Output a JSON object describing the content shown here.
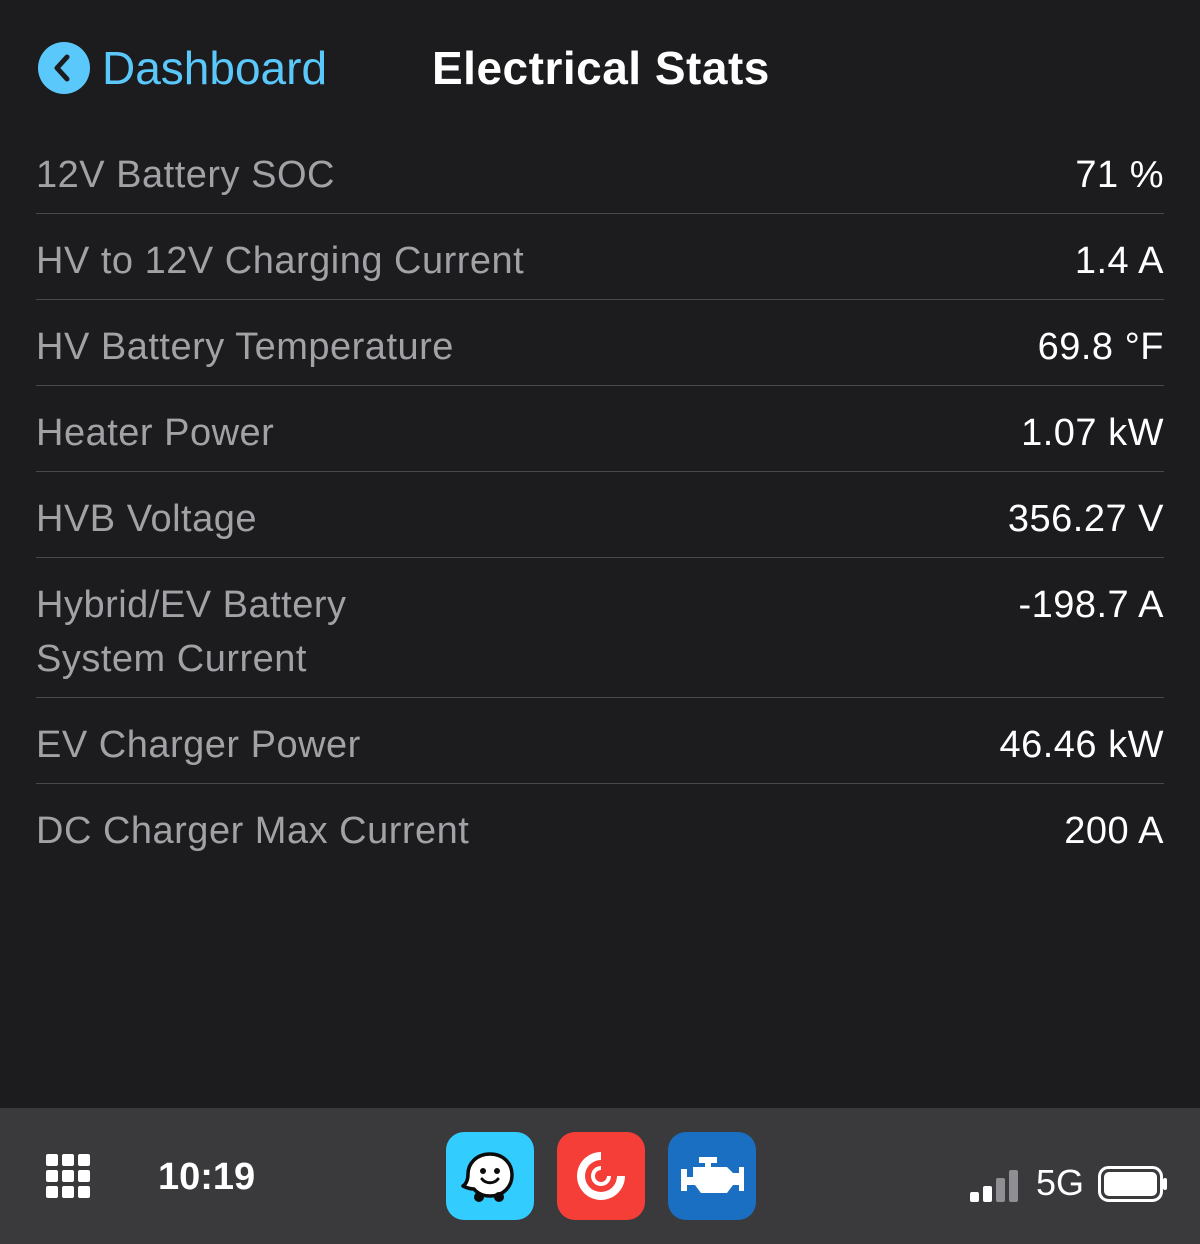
{
  "nav": {
    "back_label": "Dashboard",
    "title": "Electrical Stats"
  },
  "stats": [
    {
      "label": "12V Battery SOC",
      "value": "71 %"
    },
    {
      "label": "HV to 12V Charging Current",
      "value": "1.4 A"
    },
    {
      "label": "HV Battery Temperature",
      "value": "69.8 °F"
    },
    {
      "label": "Heater Power",
      "value": "1.07 kW"
    },
    {
      "label": "HVB Voltage",
      "value": "356.27 V"
    },
    {
      "label": "Hybrid/EV Battery\nSystem Current",
      "value": "-198.7 A"
    },
    {
      "label": "EV Charger Power",
      "value": "46.46 kW"
    },
    {
      "label": "DC Charger Max Current",
      "value": "200 A"
    }
  ],
  "dock": {
    "time": "10:19",
    "network": "5G",
    "apps": [
      "waze-icon",
      "pocket-casts-icon",
      "obd-engine-icon"
    ],
    "signal_bars_active": 2,
    "signal_bars_total": 4
  },
  "colors": {
    "background": "#1c1c1e",
    "accent": "#5ac8fa",
    "dock": "#3a3a3c",
    "waze": "#33ccff",
    "pocketcasts": "#f43e37",
    "obd": "#1b6fc2"
  }
}
